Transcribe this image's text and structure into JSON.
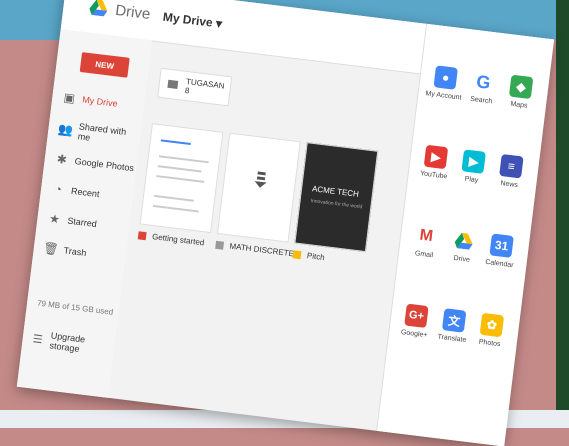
{
  "drive": {
    "title": "Drive",
    "location": "My Drive ▾",
    "new_label": "NEW",
    "nav": [
      {
        "label": "My Drive"
      },
      {
        "label": "Shared with me"
      },
      {
        "label": "Google Photos"
      },
      {
        "label": "Recent"
      },
      {
        "label": "Starred"
      },
      {
        "label": "Trash"
      }
    ],
    "storage": "79 MB of 15 GB used",
    "upgrade": "Upgrade storage",
    "folder": "TUGASAN 8",
    "files": [
      {
        "name": "Getting started"
      },
      {
        "name": "MATH DISCRETE..."
      },
      {
        "name": "Pitch"
      }
    ],
    "slide_title": "ACME TECH",
    "slide_sub": "Innovation for the world"
  },
  "apps": [
    {
      "label": "My Account",
      "color": "#4285f4",
      "icon": "account-icon"
    },
    {
      "label": "Search",
      "color": "#4285f4",
      "icon": "google-icon"
    },
    {
      "label": "Maps",
      "color": "#34a853",
      "icon": "maps-icon"
    },
    {
      "label": "YouTube",
      "color": "#e53935",
      "icon": "youtube-icon"
    },
    {
      "label": "Play",
      "color": "#00bcd4",
      "icon": "play-icon"
    },
    {
      "label": "News",
      "color": "#3f51b5",
      "icon": "news-icon"
    },
    {
      "label": "Gmail",
      "color": "#db4437",
      "icon": "gmail-icon"
    },
    {
      "label": "Drive",
      "color": "#0f9d58",
      "icon": "drive-icon"
    },
    {
      "label": "Calendar",
      "color": "#4285f4",
      "icon": "calendar-icon"
    },
    {
      "label": "Google+",
      "color": "#db4437",
      "icon": "gplus-icon"
    },
    {
      "label": "Translate",
      "color": "#4285f4",
      "icon": "translate-icon"
    },
    {
      "label": "Photos",
      "color": "#fbbc05",
      "icon": "photos-icon"
    }
  ]
}
